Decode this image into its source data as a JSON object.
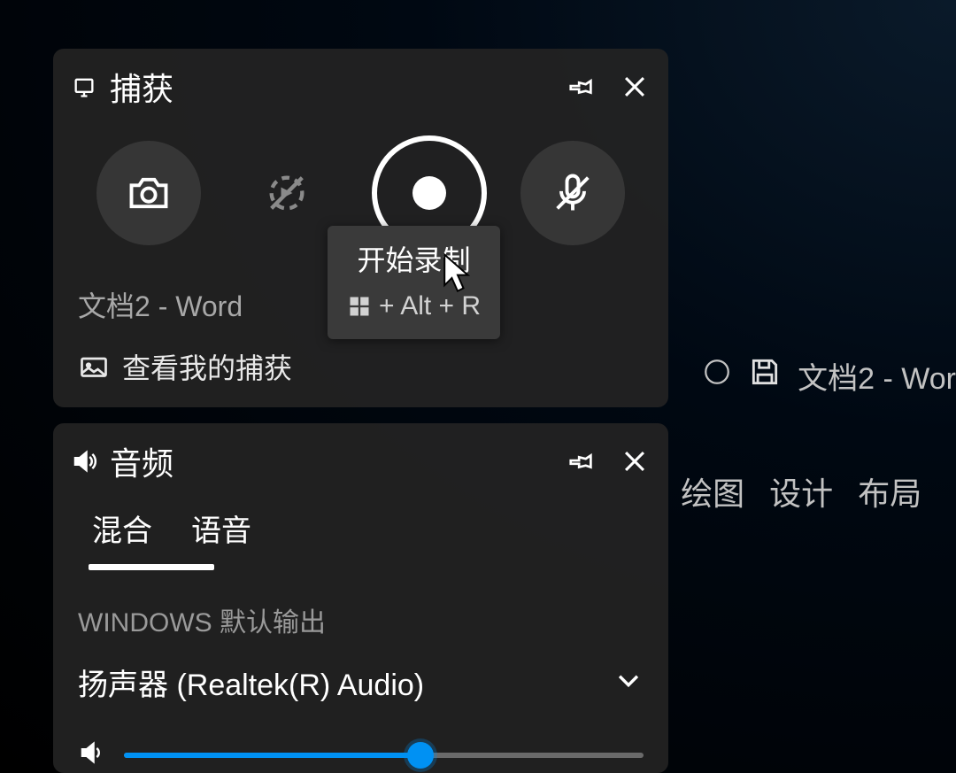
{
  "capture": {
    "title": "捕获",
    "app_name": "文档2 - Word",
    "view_captures": "查看我的捕获",
    "tooltip": {
      "title": "开始录制",
      "shortcut_text": "+ Alt + R"
    }
  },
  "audio": {
    "title": "音频",
    "tabs": {
      "mixer": "混合",
      "voice": "语音"
    },
    "default_output_label": "WINDOWS 默认输出",
    "device_name": "扬声器 (Realtek(R) Audio)",
    "slider_percent": 57
  },
  "background": {
    "doc_title": "文档2 - Wor",
    "tab_draw": "绘图",
    "tab_design": "设计",
    "tab_layout": "布局"
  }
}
